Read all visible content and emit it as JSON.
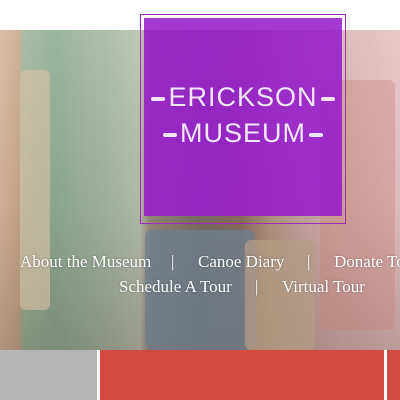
{
  "logo": {
    "line1": "ERICKSON",
    "line2": "MUSEUM",
    "color": "#961ccd"
  },
  "nav": {
    "items": [
      {
        "label": "About the Museum"
      },
      {
        "label": "Canoe Diary"
      },
      {
        "label": "Donate To"
      },
      {
        "label": "Schedule A Tour"
      },
      {
        "label": "Virtual Tour"
      }
    ],
    "separator": "|"
  },
  "tiles": {
    "colors": [
      "#b5b5b5",
      "#d14b43",
      "#d14b43"
    ]
  }
}
